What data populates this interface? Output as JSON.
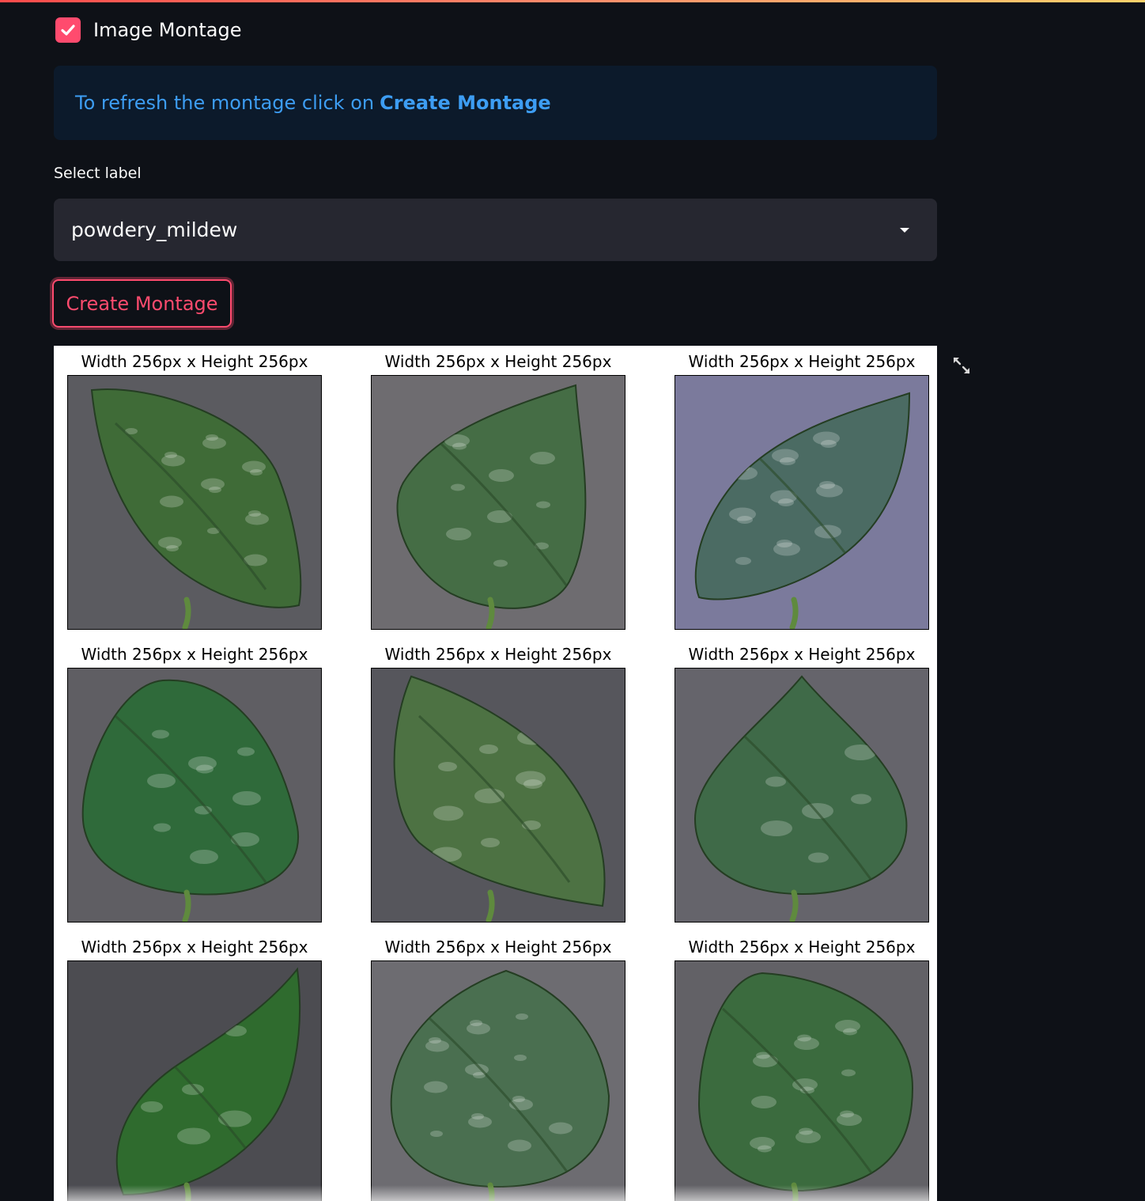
{
  "checkbox": {
    "label": "Image Montage",
    "checked": true,
    "accent_color": "#ff4b6e"
  },
  "info": {
    "text": "To refresh the montage click on",
    "emphasis": "Create Montage",
    "color": "#3d9df3"
  },
  "select": {
    "label": "Select label",
    "value": "powdery_mildew",
    "icon": "chevron-down-icon"
  },
  "button": {
    "label": "Create Montage"
  },
  "montage": {
    "fullscreen_icon": "expand-icon",
    "tiles": [
      {
        "title": "Width 256px x Height 256px",
        "background": "#5b5b60",
        "leaf": "#3f6b37",
        "mildew": "high"
      },
      {
        "title": "Width 256px x Height 256px",
        "background": "#6e6c70",
        "leaf": "#456d45",
        "mildew": "medium"
      },
      {
        "title": "Width 256px x Height 256px",
        "background": "#7b7a9c",
        "leaf": "#4b6b63",
        "mildew": "high"
      },
      {
        "title": "Width 256px x Height 256px",
        "background": "#5f5e63",
        "leaf": "#2f6a3a",
        "mildew": "medium"
      },
      {
        "title": "Width 256px x Height 256px",
        "background": "#56565c",
        "leaf": "#4d7243",
        "mildew": "medium"
      },
      {
        "title": "Width 256px x Height 256px",
        "background": "#65646b",
        "leaf": "#3f6a48",
        "mildew": "low"
      },
      {
        "title": "Width 256px x Height 256px",
        "background": "#4c4c51",
        "leaf": "#2f6b2e",
        "mildew": "low"
      },
      {
        "title": "Width 256px x Height 256px",
        "background": "#6d6c71",
        "leaf": "#4a6f50",
        "mildew": "high"
      },
      {
        "title": "Width 256px x Height 256px",
        "background": "#626166",
        "leaf": "#3b6b3e",
        "mildew": "high"
      }
    ]
  }
}
